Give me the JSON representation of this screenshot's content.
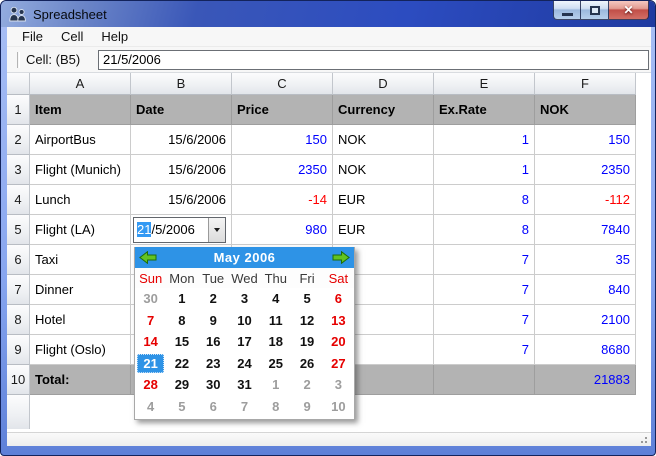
{
  "window": {
    "title": "Spreadsheet"
  },
  "menu": {
    "items": [
      "File",
      "Cell",
      "Help"
    ]
  },
  "toolbar": {
    "cell_label": "Cell: (B5)",
    "cell_value": "21/5/2006"
  },
  "spreadsheet": {
    "column_letters": [
      "A",
      "B",
      "C",
      "D",
      "E",
      "F"
    ],
    "rows": [
      {
        "n": "1",
        "band": true,
        "cells": [
          {
            "t": "Item",
            "a": "l",
            "bold": true
          },
          {
            "t": "Date",
            "a": "l",
            "bold": true
          },
          {
            "t": "Price",
            "a": "l",
            "bold": true
          },
          {
            "t": "Currency",
            "a": "l",
            "bold": true
          },
          {
            "t": "Ex.Rate",
            "a": "l",
            "bold": true
          },
          {
            "t": "NOK",
            "a": "l",
            "bold": true
          }
        ]
      },
      {
        "n": "2",
        "cells": [
          {
            "t": "AirportBus",
            "a": "l"
          },
          {
            "t": "15/6/2006",
            "a": "r"
          },
          {
            "t": "150",
            "a": "r",
            "k": "blue"
          },
          {
            "t": "NOK",
            "a": "l"
          },
          {
            "t": "1",
            "a": "r",
            "k": "blue"
          },
          {
            "t": "150",
            "a": "r",
            "k": "blue"
          }
        ]
      },
      {
        "n": "3",
        "cells": [
          {
            "t": "Flight (Munich)",
            "a": "l"
          },
          {
            "t": "15/6/2006",
            "a": "r"
          },
          {
            "t": "2350",
            "a": "r",
            "k": "blue"
          },
          {
            "t": "NOK",
            "a": "l"
          },
          {
            "t": "1",
            "a": "r",
            "k": "blue"
          },
          {
            "t": "2350",
            "a": "r",
            "k": "blue"
          }
        ]
      },
      {
        "n": "4",
        "cells": [
          {
            "t": "Lunch",
            "a": "l"
          },
          {
            "t": "15/6/2006",
            "a": "r"
          },
          {
            "t": "-14",
            "a": "r",
            "k": "red"
          },
          {
            "t": "EUR",
            "a": "l"
          },
          {
            "t": "8",
            "a": "r",
            "k": "blue"
          },
          {
            "t": "-112",
            "a": "r",
            "k": "red"
          }
        ]
      },
      {
        "n": "5",
        "cells": [
          {
            "t": "Flight (LA)",
            "a": "l"
          },
          {
            "combo": true
          },
          {
            "t": "980",
            "a": "r",
            "k": "blue"
          },
          {
            "t": "EUR",
            "a": "l"
          },
          {
            "t": "8",
            "a": "r",
            "k": "blue"
          },
          {
            "t": "7840",
            "a": "r",
            "k": "blue"
          }
        ]
      },
      {
        "n": "6",
        "cells": [
          {
            "t": "Taxi",
            "a": "l"
          },
          {
            "t": "",
            "a": "l"
          },
          {
            "t": "",
            "a": "l"
          },
          {
            "t": "",
            "a": "l"
          },
          {
            "t": "7",
            "a": "r",
            "k": "blue"
          },
          {
            "t": "35",
            "a": "r",
            "k": "blue"
          }
        ]
      },
      {
        "n": "7",
        "cells": [
          {
            "t": "Dinner",
            "a": "l"
          },
          {
            "t": "",
            "a": "l"
          },
          {
            "t": "",
            "a": "l"
          },
          {
            "t": "",
            "a": "l"
          },
          {
            "t": "7",
            "a": "r",
            "k": "blue"
          },
          {
            "t": "840",
            "a": "r",
            "k": "blue"
          }
        ]
      },
      {
        "n": "8",
        "cells": [
          {
            "t": "Hotel",
            "a": "l"
          },
          {
            "t": "",
            "a": "l"
          },
          {
            "t": "",
            "a": "l"
          },
          {
            "t": "",
            "a": "l"
          },
          {
            "t": "7",
            "a": "r",
            "k": "blue"
          },
          {
            "t": "2100",
            "a": "r",
            "k": "blue"
          }
        ]
      },
      {
        "n": "9",
        "cells": [
          {
            "t": "Flight (Oslo)",
            "a": "l"
          },
          {
            "t": "",
            "a": "l"
          },
          {
            "t": "",
            "a": "l"
          },
          {
            "t": "",
            "a": "l"
          },
          {
            "t": "7",
            "a": "r",
            "k": "blue"
          },
          {
            "t": "8680",
            "a": "r",
            "k": "blue"
          }
        ]
      },
      {
        "n": "10",
        "band": true,
        "cells": [
          {
            "t": "Total:",
            "a": "l",
            "bold": true
          },
          {
            "t": "",
            "a": "l"
          },
          {
            "t": "",
            "a": "l"
          },
          {
            "t": "",
            "a": "l"
          },
          {
            "t": "",
            "a": "l"
          },
          {
            "t": "21883",
            "a": "r",
            "k": "blue"
          }
        ]
      }
    ]
  },
  "combo": {
    "selected_text": "21",
    "rest_text": "/5/2006"
  },
  "calendar": {
    "month_label": "May 2006",
    "selected_day": "21",
    "day_names": [
      {
        "t": "Sun",
        "k": "we"
      },
      {
        "t": "Mon",
        "k": "wk"
      },
      {
        "t": "Tue",
        "k": "wk"
      },
      {
        "t": "Wed",
        "k": "wk"
      },
      {
        "t": "Thu",
        "k": "wk"
      },
      {
        "t": "Fri",
        "k": "wk"
      },
      {
        "t": "Sat",
        "k": "we"
      }
    ],
    "weeks": [
      [
        {
          "t": "30",
          "k": "dim"
        },
        {
          "t": "1",
          "k": "wk"
        },
        {
          "t": "2",
          "k": "wk"
        },
        {
          "t": "3",
          "k": "wk"
        },
        {
          "t": "4",
          "k": "wk"
        },
        {
          "t": "5",
          "k": "wk"
        },
        {
          "t": "6",
          "k": "we"
        }
      ],
      [
        {
          "t": "7",
          "k": "we"
        },
        {
          "t": "8",
          "k": "wk"
        },
        {
          "t": "9",
          "k": "wk"
        },
        {
          "t": "10",
          "k": "wk"
        },
        {
          "t": "11",
          "k": "wk"
        },
        {
          "t": "12",
          "k": "wk"
        },
        {
          "t": "13",
          "k": "we"
        }
      ],
      [
        {
          "t": "14",
          "k": "we"
        },
        {
          "t": "15",
          "k": "wk"
        },
        {
          "t": "16",
          "k": "wk"
        },
        {
          "t": "17",
          "k": "wk"
        },
        {
          "t": "18",
          "k": "wk"
        },
        {
          "t": "19",
          "k": "wk"
        },
        {
          "t": "20",
          "k": "we"
        }
      ],
      [
        {
          "t": "21",
          "k": "sel"
        },
        {
          "t": "22",
          "k": "wk"
        },
        {
          "t": "23",
          "k": "wk"
        },
        {
          "t": "24",
          "k": "wk"
        },
        {
          "t": "25",
          "k": "wk"
        },
        {
          "t": "26",
          "k": "wk"
        },
        {
          "t": "27",
          "k": "we"
        }
      ],
      [
        {
          "t": "28",
          "k": "we"
        },
        {
          "t": "29",
          "k": "wk"
        },
        {
          "t": "30",
          "k": "wk"
        },
        {
          "t": "31",
          "k": "wk"
        },
        {
          "t": "1",
          "k": "dim"
        },
        {
          "t": "2",
          "k": "dim"
        },
        {
          "t": "3",
          "k": "dim"
        }
      ],
      [
        {
          "t": "4",
          "k": "dim"
        },
        {
          "t": "5",
          "k": "dim"
        },
        {
          "t": "6",
          "k": "dim"
        },
        {
          "t": "7",
          "k": "dim"
        },
        {
          "t": "8",
          "k": "dim"
        },
        {
          "t": "9",
          "k": "dim"
        },
        {
          "t": "10",
          "k": "dim"
        }
      ]
    ]
  },
  "colors": {
    "value_blue": "#0000ff",
    "value_red": "#ff0000",
    "band_gray": "#b3b3b3",
    "calendar_blue": "#2e93e6",
    "weekend_red": "#e60000",
    "titlebar_blue": "#2c4cc0",
    "frame_blue": "#88a6f0"
  }
}
